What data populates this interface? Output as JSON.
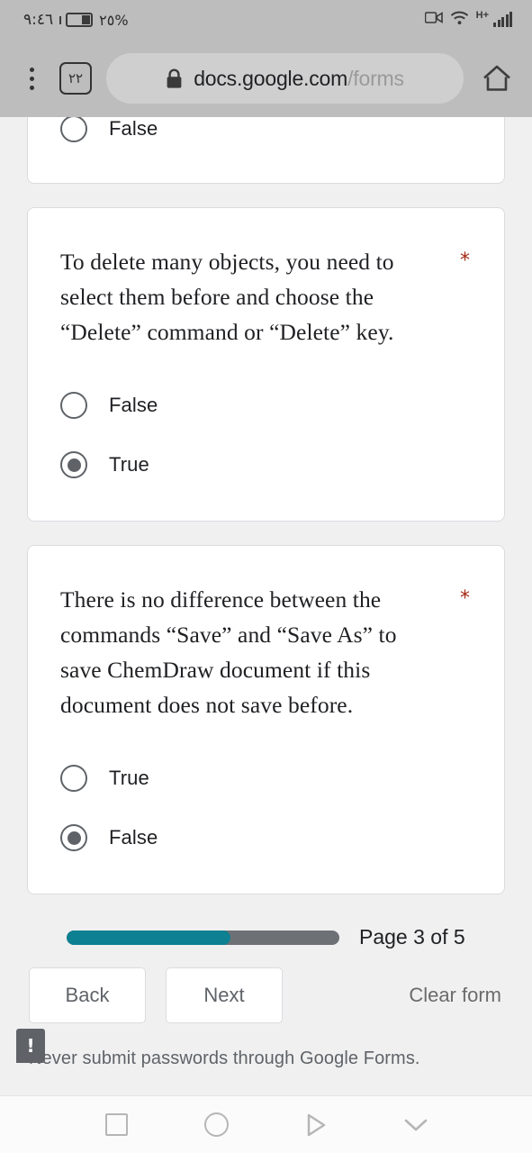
{
  "status_bar": {
    "time": "٩:٤٦",
    "battery_percent": "٢٥%",
    "network_type": "H+",
    "icons": [
      "video-camera-icon",
      "wifi-icon",
      "signal-bars-icon"
    ]
  },
  "browser": {
    "tab_count": "٢٢",
    "url_domain": "docs.google.com",
    "url_path": "/forms",
    "secure": true,
    "menu_icon": "overflow-menu-icon",
    "home_icon": "home-icon",
    "lock_icon": "lock-icon"
  },
  "form": {
    "partial_card": {
      "options": [
        {
          "label": "False",
          "selected": false
        }
      ]
    },
    "questions": [
      {
        "text": "To delete many objects, you need to select them before and choose the “Delete” command or “Delete” key.",
        "required_marker": "*",
        "options": [
          {
            "label": "False",
            "selected": false
          },
          {
            "label": "True",
            "selected": true
          }
        ]
      },
      {
        "text": "There is no difference between the commands “Save” and “Save As” to save ChemDraw document if this document does not save before.",
        "required_marker": "*",
        "options": [
          {
            "label": "True",
            "selected": false
          },
          {
            "label": "False",
            "selected": true
          }
        ]
      }
    ],
    "progress": {
      "label": "Page 3 of 5",
      "current_page": 3,
      "total_pages": 5,
      "percent": 60,
      "fill_color": "#0d8092",
      "track_color": "#6d7176"
    },
    "navigation": {
      "back_label": "Back",
      "next_label": "Next",
      "clear_label": "Clear form"
    },
    "footer_note": "Never submit passwords through Google Forms.",
    "warning_badge": "!"
  },
  "android_nav": {
    "buttons": [
      {
        "icon": "recents-square-icon"
      },
      {
        "icon": "home-circle-icon"
      },
      {
        "icon": "back-triangle-icon"
      },
      {
        "icon": "hide-navbar-chevron-down-icon"
      }
    ]
  }
}
